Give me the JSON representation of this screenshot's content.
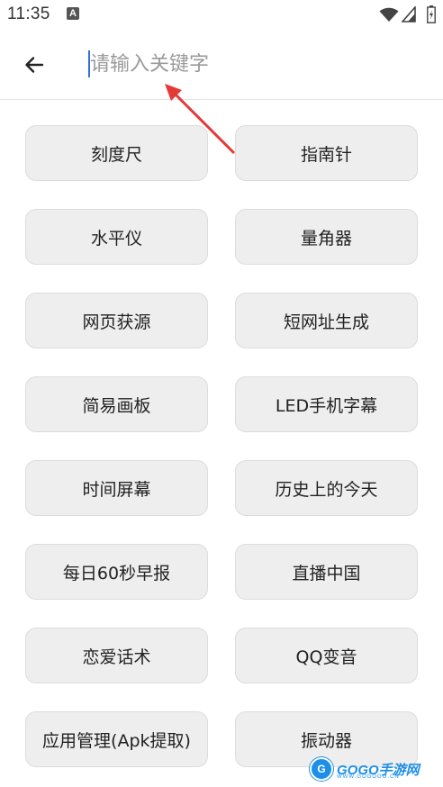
{
  "status_bar": {
    "time": "11:35",
    "notification_icon": "a-badge-icon",
    "wifi_icon": "wifi-icon",
    "signal_icon": "signal-icon",
    "battery_icon": "battery-icon"
  },
  "header": {
    "back_icon": "arrow-left-icon",
    "search_placeholder": "请输入关键字",
    "search_value": ""
  },
  "annotation": {
    "arrow_color": "#e53935"
  },
  "tools": [
    {
      "label": "刻度尺"
    },
    {
      "label": "指南针"
    },
    {
      "label": "水平仪"
    },
    {
      "label": "量角器"
    },
    {
      "label": "网页获源"
    },
    {
      "label": "短网址生成"
    },
    {
      "label": "简易画板"
    },
    {
      "label": "LED手机字幕"
    },
    {
      "label": "时间屏幕"
    },
    {
      "label": "历史上的今天"
    },
    {
      "label": "每日60秒早报"
    },
    {
      "label": "直播中国"
    },
    {
      "label": "恋爱话术"
    },
    {
      "label": "QQ变音"
    },
    {
      "label": "应用管理(Apk提取)"
    },
    {
      "label": "振动器"
    }
  ],
  "watermark": {
    "logo_letter": "G",
    "text": "GOGO手游网",
    "subtext": "WWW.GOGOGO.CN"
  },
  "colors": {
    "button_bg": "#eeeeee",
    "button_border": "#dcdcdc",
    "accent_cursor": "#2f6fe0",
    "watermark_blue": "#1e8fe8"
  }
}
